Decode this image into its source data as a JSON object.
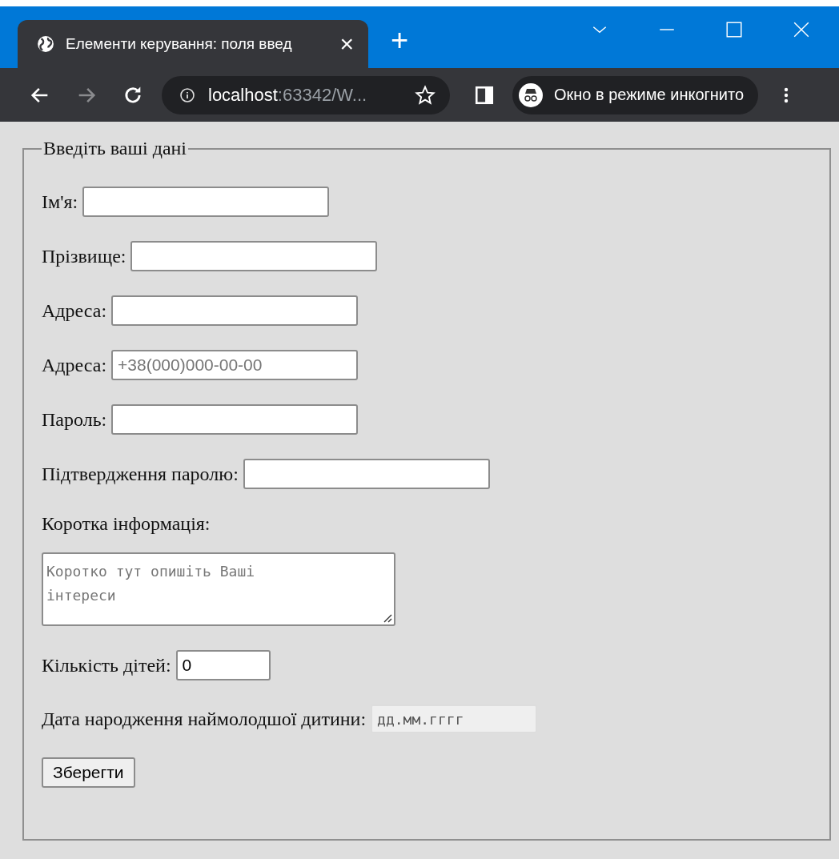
{
  "browser": {
    "tab_title": "Елементи керування: поля введ",
    "tab_close": "×",
    "new_tab": "+",
    "address_host": "localhost",
    "address_rest": ":63342/W...",
    "profile_label": "Окно в режиме инкогнито"
  },
  "form": {
    "legend": "Введіть ваші дані",
    "rows": [
      {
        "kind": "text",
        "label": "Ім'я:"
      },
      {
        "kind": "text",
        "label": "Прізвище:"
      },
      {
        "kind": "text",
        "label": "Адреса:"
      },
      {
        "kind": "text",
        "label": "Адреса:",
        "placeholder": "+38(000)000-00-00"
      },
      {
        "kind": "text",
        "label": "Пароль:"
      },
      {
        "kind": "text",
        "label": "Підтвердження паролю:"
      },
      {
        "kind": "textarea",
        "label": "Коротка інформація:",
        "placeholder": "Коротко тут опишіть Ваші інтереси"
      },
      {
        "kind": "number",
        "label": "Кількість дітей:",
        "value": "0"
      },
      {
        "kind": "date",
        "label": "Дата народження наймолодшої дитини:",
        "placeholder": "дд.мм.гггг"
      }
    ],
    "button": "Зберегти"
  }
}
